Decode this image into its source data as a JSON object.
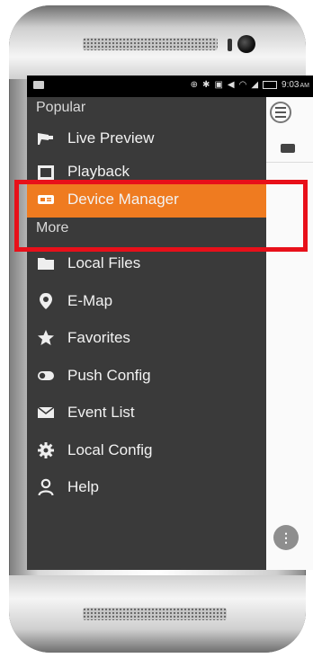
{
  "status_bar": {
    "time": "9:03",
    "am_pm": "AM"
  },
  "drawer": {
    "sections": [
      {
        "header": "Popular"
      },
      {
        "header": "More"
      }
    ],
    "items": [
      {
        "label": "Live Preview",
        "icon": "camera-icon"
      },
      {
        "label": "Playback",
        "icon": "film-icon"
      },
      {
        "label": "Device Manager",
        "icon": "device-card-icon",
        "active": true
      },
      {
        "label": "Local Files",
        "icon": "folder-icon"
      },
      {
        "label": "E-Map",
        "icon": "map-pin-icon"
      },
      {
        "label": "Favorites",
        "icon": "star-icon"
      },
      {
        "label": "Push Config",
        "icon": "toggle-icon"
      },
      {
        "label": "Event List",
        "icon": "envelope-icon"
      },
      {
        "label": "Local Config",
        "icon": "gear-icon"
      },
      {
        "label": "Help",
        "icon": "user-icon"
      }
    ]
  },
  "colors": {
    "accent": "#ef7b20",
    "drawer_bg": "#3a3a3a",
    "highlight_box": "#e8101a"
  }
}
